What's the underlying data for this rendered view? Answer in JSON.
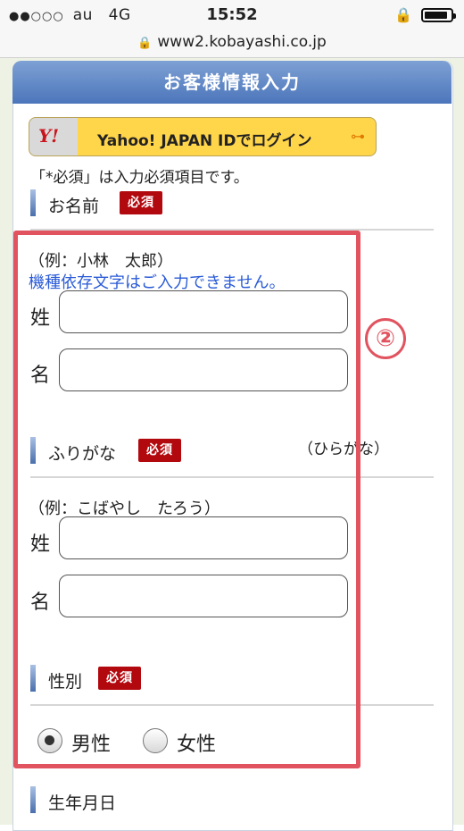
{
  "status_bar": {
    "carrier": "au",
    "network": "4G",
    "time": "15:52",
    "signal_dots": "●●○○○",
    "battery_level": 0.9
  },
  "browser": {
    "url": "www2.kobayashi.co.jp"
  },
  "panel": {
    "title": "お客様情報入力"
  },
  "yahoo_login": {
    "logo": "Y!",
    "label": "Yahoo! JAPAN IDでログイン"
  },
  "required_note": "「*必須」は入力必須項目です。",
  "required_badge": "必須",
  "name_section": {
    "label": "お名前",
    "example": "（例：小林　太郎）",
    "warning": "機種依存文字はご入力できません。",
    "last_label": "姓",
    "first_label": "名",
    "last_value": "",
    "first_value": ""
  },
  "furigana_section": {
    "label": "ふりがな",
    "hint": "（ひらがな）",
    "example": "（例：こばやし　たろう）",
    "last_label": "姓",
    "first_label": "名",
    "last_value": "",
    "first_value": ""
  },
  "gender_section": {
    "label": "性別",
    "options": [
      {
        "label": "男性",
        "selected": true
      },
      {
        "label": "女性",
        "selected": false
      }
    ]
  },
  "birthdate_section": {
    "label": "生年月日"
  },
  "annotation": {
    "number": "②",
    "color": "#e0535f"
  },
  "colors": {
    "header": "#4c76bb",
    "required": "#b2090f",
    "warning": "#2a5bd7",
    "yahoo": "#ffd54a"
  }
}
